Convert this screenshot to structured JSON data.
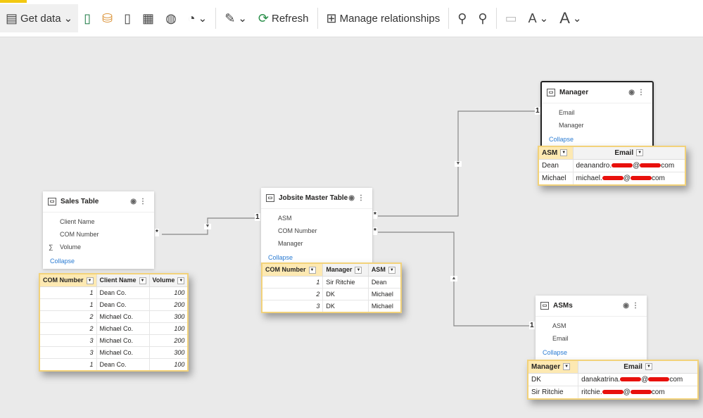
{
  "toolbar": {
    "get_data": "Get data",
    "refresh": "Refresh",
    "manage_relationships": "Manage relationships"
  },
  "tables": {
    "sales": {
      "title": "Sales Table",
      "fields": [
        "Client Name",
        "COM Number",
        "Volume"
      ],
      "collapse": "Collapse",
      "headers": [
        "COM Number",
        "Client Name",
        "Volume"
      ],
      "rows": [
        [
          "1",
          "Dean Co.",
          "100"
        ],
        [
          "1",
          "Dean Co.",
          "200"
        ],
        [
          "2",
          "Michael Co.",
          "300"
        ],
        [
          "2",
          "Michael Co.",
          "100"
        ],
        [
          "3",
          "Michael Co.",
          "200"
        ],
        [
          "3",
          "Michael Co.",
          "300"
        ],
        [
          "1",
          "Dean Co.",
          "100"
        ]
      ]
    },
    "jobsite": {
      "title": "Jobsite Master Table",
      "fields": [
        "ASM",
        "COM Number",
        "Manager"
      ],
      "collapse": "Collapse",
      "headers": [
        "COM Number",
        "Manager",
        "ASM"
      ],
      "rows": [
        [
          "1",
          "Sir Ritchie",
          "Dean"
        ],
        [
          "2",
          "DK",
          "Michael"
        ],
        [
          "3",
          "DK",
          "Michael"
        ]
      ]
    },
    "manager": {
      "title": "Manager",
      "fields": [
        "Email",
        "Manager"
      ],
      "collapse": "Collapse",
      "headers": [
        "ASM",
        "Email"
      ],
      "rows": [
        [
          "Dean",
          "deanandro.",
          "@",
          "com"
        ],
        [
          "Michael",
          "michael.",
          "@",
          "com"
        ]
      ]
    },
    "asms": {
      "title": "ASMs",
      "fields": [
        "ASM",
        "Email"
      ],
      "collapse": "Collapse",
      "headers": [
        "Manager",
        "Email"
      ],
      "rows": [
        [
          "DK",
          "danakatrina.",
          "@",
          "com"
        ],
        [
          "Sir Ritchie",
          "ritchie.",
          "@",
          "com"
        ]
      ]
    }
  },
  "relationships": {
    "one": "1",
    "many": "*"
  },
  "colors": {
    "accent": "#f2c811",
    "link": "#2b7cd3",
    "redaction": "#e8100c"
  }
}
